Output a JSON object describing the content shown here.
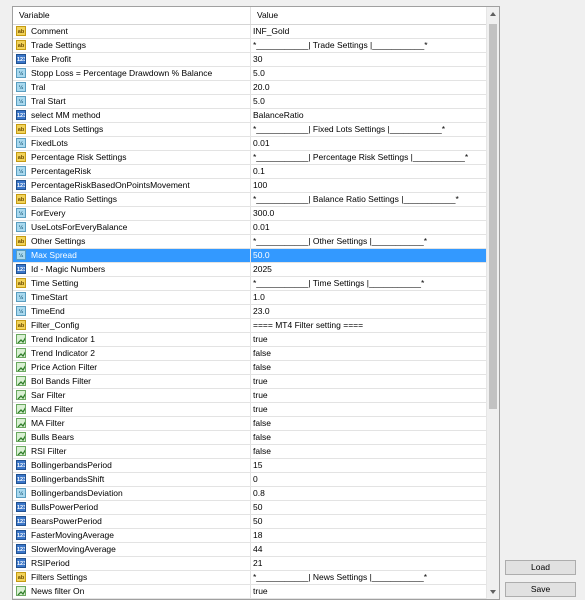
{
  "columns": {
    "variable": "Variable",
    "value": "Value"
  },
  "rows": [
    {
      "type": "str",
      "name": "Comment",
      "value": "INF_Gold"
    },
    {
      "type": "str",
      "name": "Trade Settings",
      "value": "*___________| Trade Settings |___________*"
    },
    {
      "type": "int",
      "name": "Take Profit",
      "value": "30"
    },
    {
      "type": "dbl",
      "name": "Stopp Loss = Percentage Drawdown % Balance",
      "value": "5.0"
    },
    {
      "type": "dbl",
      "name": "Tral",
      "value": "20.0"
    },
    {
      "type": "dbl",
      "name": "Tral Start",
      "value": "5.0"
    },
    {
      "type": "int",
      "name": "select MM method",
      "value": "BalanceRatio"
    },
    {
      "type": "str",
      "name": "Fixed Lots Settings",
      "value": "*___________| Fixed Lots Settings |___________*"
    },
    {
      "type": "dbl",
      "name": "FixedLots",
      "value": "0.01"
    },
    {
      "type": "str",
      "name": "Percentage Risk Settings",
      "value": "*___________| Percentage Risk Settings |___________*"
    },
    {
      "type": "dbl",
      "name": "PercentageRisk",
      "value": "0.1"
    },
    {
      "type": "int",
      "name": "PercentageRiskBasedOnPointsMovement",
      "value": "100"
    },
    {
      "type": "str",
      "name": "Balance Ratio Settings",
      "value": "*___________| Balance Ratio Settings |___________*"
    },
    {
      "type": "dbl",
      "name": "ForEvery",
      "value": "300.0"
    },
    {
      "type": "dbl",
      "name": "UseLotsForEveryBalance",
      "value": "0.01"
    },
    {
      "type": "str",
      "name": "Other Settings",
      "value": "*___________| Other Settings |___________*"
    },
    {
      "type": "dbl",
      "name": "Max Spread",
      "value": "50.0",
      "selected": true
    },
    {
      "type": "int",
      "name": "Id - Magic Numbers",
      "value": "2025"
    },
    {
      "type": "str",
      "name": "Time Setting",
      "value": "*___________| Time Settings |___________*"
    },
    {
      "type": "dbl",
      "name": "TimeStart",
      "value": "1.0"
    },
    {
      "type": "dbl",
      "name": "TimeEnd",
      "value": "23.0"
    },
    {
      "type": "str",
      "name": "Filter_Config",
      "value": "==== MT4 Filter setting ===="
    },
    {
      "type": "bool",
      "name": "Trend Indicator 1",
      "value": "true"
    },
    {
      "type": "bool",
      "name": "Trend Indicator 2",
      "value": "false"
    },
    {
      "type": "bool",
      "name": "Price Action Filter",
      "value": "false"
    },
    {
      "type": "bool",
      "name": "Bol Bands Filter",
      "value": "true"
    },
    {
      "type": "bool",
      "name": "Sar Filter",
      "value": "true"
    },
    {
      "type": "bool",
      "name": "Macd Filter",
      "value": "true"
    },
    {
      "type": "bool",
      "name": "MA Filter",
      "value": "false"
    },
    {
      "type": "bool",
      "name": "Bulls Bears",
      "value": "false"
    },
    {
      "type": "bool",
      "name": "RSI Filter",
      "value": "false"
    },
    {
      "type": "int",
      "name": "BollingerbandsPeriod",
      "value": "15"
    },
    {
      "type": "int",
      "name": "BollingerbandsShift",
      "value": "0"
    },
    {
      "type": "dbl",
      "name": "BollingerbandsDeviation",
      "value": "0.8"
    },
    {
      "type": "int",
      "name": "BullsPowerPeriod",
      "value": "50"
    },
    {
      "type": "int",
      "name": "BearsPowerPeriod",
      "value": "50"
    },
    {
      "type": "int",
      "name": "FasterMovingAverage",
      "value": "18"
    },
    {
      "type": "int",
      "name": "SlowerMovingAverage",
      "value": "44"
    },
    {
      "type": "int",
      "name": "RSIPeriod",
      "value": "21"
    },
    {
      "type": "str",
      "name": "Filters Settings",
      "value": "*___________| News Settings |___________*"
    },
    {
      "type": "bool",
      "name": "News filter On",
      "value": "true"
    }
  ],
  "icon_text": {
    "str": "ab",
    "int": "123",
    "dbl": "½"
  },
  "buttons": {
    "load": "Load",
    "save": "Save"
  },
  "colors": {
    "selection": "#3399ff"
  }
}
